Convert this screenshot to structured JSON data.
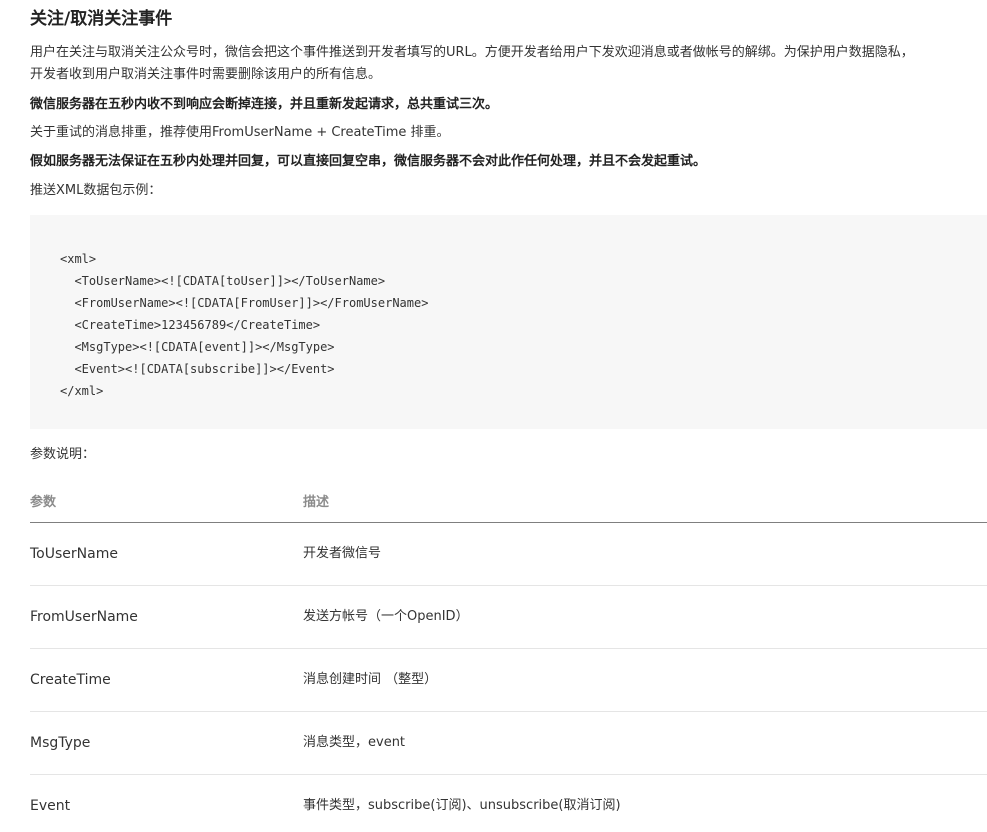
{
  "title": "关注/取消关注事件",
  "paragraphs": {
    "intro_line1": "用户在关注与取消关注公众号时，微信会把这个事件推送到开发者填写的URL。方便开发者给用户下发欢迎消息或者做帐号的解绑。为保护用户数据隐私，",
    "intro_line2": "开发者收到用户取消关注事件时需要删除该用户的所有信息。",
    "retry_notice": "微信服务器在五秒内收不到响应会断掉连接，并且重新发起请求，总共重试三次。",
    "dedupe_notice": "关于重试的消息排重，推荐使用FromUserName + CreateTime 排重。",
    "empty_reply_notice": "假如服务器无法保证在五秒内处理并回复，可以直接回复空串，微信服务器不会对此作任何处理，并且不会发起重试。",
    "xml_example_label": "推送XML数据包示例："
  },
  "code": {
    "lines": [
      "<xml>",
      "  <ToUserName><![CDATA[toUser]]></ToUserName>",
      "  <FromUserName><![CDATA[FromUser]]></FromUserName>",
      "  <CreateTime>123456789</CreateTime>",
      "  <MsgType><![CDATA[event]]></MsgType>",
      "  <Event><![CDATA[subscribe]]></Event>",
      "</xml>"
    ]
  },
  "params": {
    "label": "参数说明：",
    "headers": [
      "参数",
      "描述"
    ],
    "rows": [
      {
        "name": "ToUserName",
        "desc": "开发者微信号"
      },
      {
        "name": "FromUserName",
        "desc": "发送方帐号（一个OpenID）"
      },
      {
        "name": "CreateTime",
        "desc": "消息创建时间 （整型）"
      },
      {
        "name": "MsgType",
        "desc": "消息类型，event"
      },
      {
        "name": "Event",
        "desc": "事件类型，subscribe(订阅)、unsubscribe(取消订阅)"
      }
    ]
  }
}
